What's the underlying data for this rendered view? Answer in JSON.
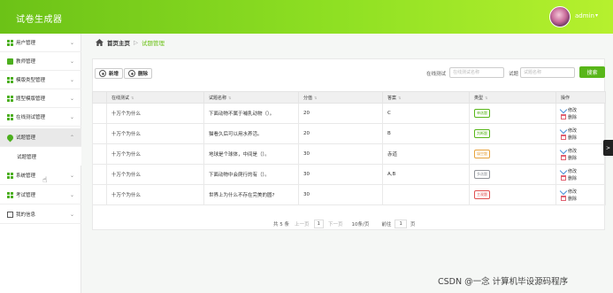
{
  "app": {
    "title": "试卷生成器",
    "user": "admin",
    "caret": "▾"
  },
  "sidebar": {
    "items": [
      {
        "label": "用户管理",
        "icon": "grid-icon"
      },
      {
        "label": "教师管理",
        "icon": "chat-icon"
      },
      {
        "label": "模版类型管理",
        "icon": "grid-icon"
      },
      {
        "label": "题型模版管理",
        "icon": "grid-icon"
      },
      {
        "label": "在线测试管理",
        "icon": "grid-icon"
      },
      {
        "label": "试题管理",
        "icon": "pin-icon"
      },
      {
        "label": "系统管理",
        "icon": "grid-icon"
      },
      {
        "label": "考试管理",
        "icon": "grid-icon"
      },
      {
        "label": "我的信息",
        "icon": "doc-icon"
      }
    ],
    "sub_item": "试题管理"
  },
  "breadcrumb": {
    "home": "首页主页",
    "separator": "▷",
    "current": "试题管理"
  },
  "toolbar": {
    "add_label": "新增",
    "delete_label": "删除"
  },
  "search": {
    "label1": "在线测试",
    "placeholder1": "在线测试名称",
    "label2": "试题",
    "placeholder2": "试题名称",
    "button": "搜索"
  },
  "table": {
    "headers": [
      "在线测试",
      "试题名称",
      "分值",
      "答案",
      "类型",
      "操作"
    ],
    "rows": [
      {
        "test": "十万个为什么",
        "question": "下面动物不属于哺乳动物（）。",
        "score": "20",
        "answer": "C",
        "type": "单选题",
        "type_color": "#58b619"
      },
      {
        "test": "十万个为什么",
        "question": "猫看久后可以用水养活。",
        "score": "20",
        "answer": "B",
        "type": "判断题",
        "type_color": "#58b619"
      },
      {
        "test": "十万个为什么",
        "question": "地球是个球体，中间是（）。",
        "score": "30",
        "answer": "赤道",
        "type": "填空题",
        "type_color": "#e6a23c"
      },
      {
        "test": "十万个为什么",
        "question": "下面动物中会爬行的有（）。",
        "score": "30",
        "answer": "A,B",
        "type": "多选题",
        "type_color": "#909399"
      },
      {
        "test": "十万个为什么",
        "question": "世界上为什么不存在完美的圆?",
        "score": "30",
        "answer": "",
        "type": "主观题",
        "type_color": "#e05050"
      }
    ],
    "edit_label": "修改",
    "delete_label": "删除"
  },
  "pager": {
    "total": "共 5 条",
    "prev": "上一页",
    "page": "1",
    "next": "下一页",
    "size": "10条/页",
    "goto_label": "前往",
    "goto_value": "1",
    "page_unit": "页"
  },
  "side_tab": ">",
  "watermark": "CSDN @一念 计算机毕设源码程序"
}
